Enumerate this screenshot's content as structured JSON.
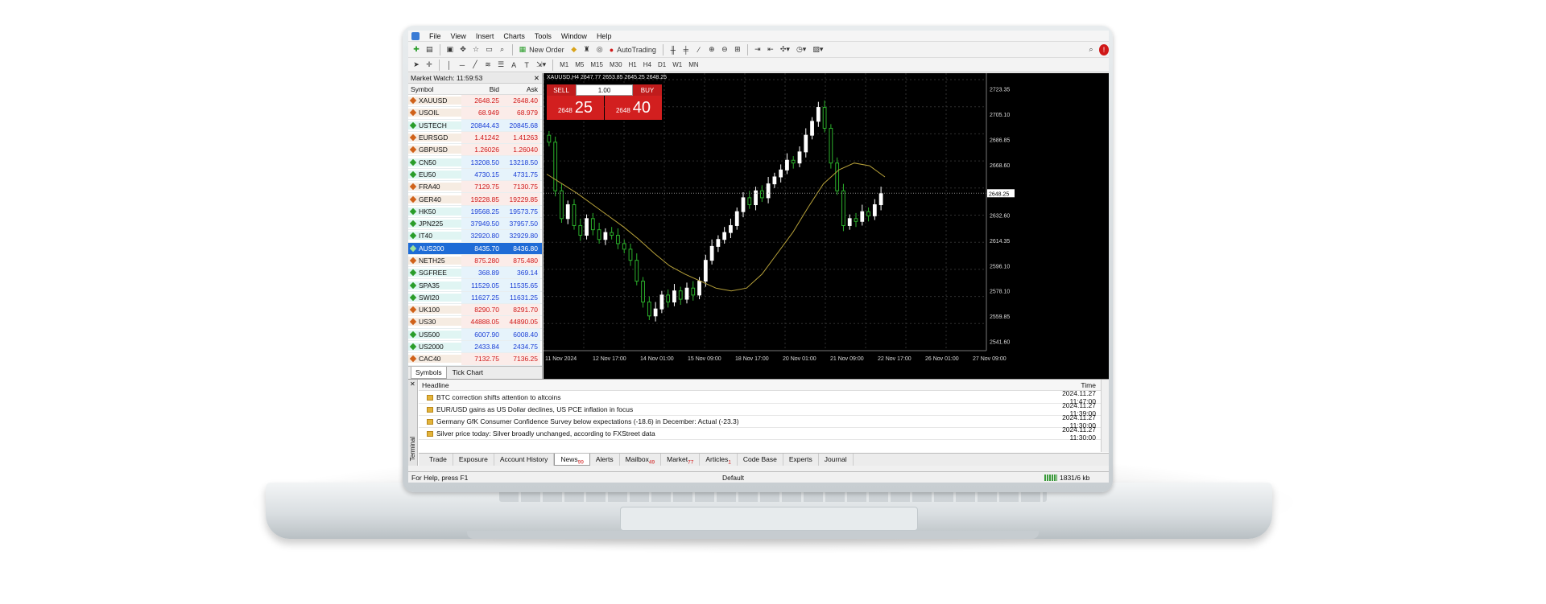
{
  "menu": [
    "File",
    "View",
    "Insert",
    "Charts",
    "Tools",
    "Window",
    "Help"
  ],
  "toolbar": {
    "new_order": "New Order",
    "autotrading": "AutoTrading"
  },
  "timeframes": [
    "M1",
    "M5",
    "M15",
    "M30",
    "H1",
    "H4",
    "D1",
    "W1",
    "MN"
  ],
  "market_watch": {
    "title": "Market Watch: 11:59:53",
    "headers": {
      "symbol": "Symbol",
      "bid": "Bid",
      "ask": "Ask"
    },
    "rows": [
      {
        "symbol": "XAUUSD",
        "bid": "2648.25",
        "ask": "2648.40",
        "dir": "down"
      },
      {
        "symbol": "USOIL",
        "bid": "68.949",
        "ask": "68.979",
        "dir": "down"
      },
      {
        "symbol": "USTECH",
        "bid": "20844.43",
        "ask": "20845.68",
        "dir": "up"
      },
      {
        "symbol": "EURSGD",
        "bid": "1.41242",
        "ask": "1.41263",
        "dir": "down"
      },
      {
        "symbol": "GBPUSD",
        "bid": "1.26026",
        "ask": "1.26040",
        "dir": "down"
      },
      {
        "symbol": "CN50",
        "bid": "13208.50",
        "ask": "13218.50",
        "dir": "up"
      },
      {
        "symbol": "EU50",
        "bid": "4730.15",
        "ask": "4731.75",
        "dir": "up"
      },
      {
        "symbol": "FRA40",
        "bid": "7129.75",
        "ask": "7130.75",
        "dir": "down"
      },
      {
        "symbol": "GER40",
        "bid": "19228.85",
        "ask": "19229.85",
        "dir": "down"
      },
      {
        "symbol": "HK50",
        "bid": "19568.25",
        "ask": "19573.75",
        "dir": "up"
      },
      {
        "symbol": "JPN225",
        "bid": "37949.50",
        "ask": "37957.50",
        "dir": "up"
      },
      {
        "symbol": "IT40",
        "bid": "32920.80",
        "ask": "32929.80",
        "dir": "up"
      },
      {
        "symbol": "AUS200",
        "bid": "8435.70",
        "ask": "8436.80",
        "dir": "sel"
      },
      {
        "symbol": "NETH25",
        "bid": "875.280",
        "ask": "875.480",
        "dir": "down"
      },
      {
        "symbol": "SGFREE",
        "bid": "368.89",
        "ask": "369.14",
        "dir": "up"
      },
      {
        "symbol": "SPA35",
        "bid": "11529.05",
        "ask": "11535.65",
        "dir": "up"
      },
      {
        "symbol": "SWI20",
        "bid": "11627.25",
        "ask": "11631.25",
        "dir": "up"
      },
      {
        "symbol": "UK100",
        "bid": "8290.70",
        "ask": "8291.70",
        "dir": "down"
      },
      {
        "symbol": "US30",
        "bid": "44888.05",
        "ask": "44890.05",
        "dir": "down"
      },
      {
        "symbol": "US500",
        "bid": "6007.90",
        "ask": "6008.40",
        "dir": "up"
      },
      {
        "symbol": "US2000",
        "bid": "2433.84",
        "ask": "2434.75",
        "dir": "up"
      },
      {
        "symbol": "CAC40",
        "bid": "7132.75",
        "ask": "7136.25",
        "dir": "down"
      }
    ],
    "tabs": [
      "Symbols",
      "Tick Chart"
    ]
  },
  "chart": {
    "title": "XAUUSD,H4  2647.77 2653.85 2645.25 2648.25",
    "sell_label": "SELL",
    "buy_label": "BUY",
    "lot": "1.00",
    "sell_small": "2648",
    "sell_big": "25",
    "buy_small": "2648",
    "buy_big": "40",
    "price_labels": [
      "2723.35",
      "2705.10",
      "2686.85",
      "2668.60",
      "2648.25",
      "2632.60",
      "2614.35",
      "2596.10",
      "2578.10",
      "2559.85",
      "2541.60"
    ],
    "time_labels": [
      "11 Nov 2024",
      "12 Nov 17:00",
      "14 Nov 01:00",
      "15 Nov 09:00",
      "18 Nov 17:00",
      "20 Nov 01:00",
      "21 Nov 09:00",
      "22 Nov 17:00",
      "26 Nov 01:00",
      "27 Nov 09:00"
    ],
    "colors": {
      "up": "#ffffff",
      "down": "#2bb02b",
      "ma": "#b8a23a",
      "grid": "#2f2f2f"
    }
  },
  "chart_data": {
    "type": "candlestick",
    "symbol": "XAUUSD",
    "timeframe": "H4",
    "ylim": [
      2535,
      2730
    ],
    "series": [
      {
        "name": "price",
        "values": [
          2685,
          2650,
          2630,
          2640,
          2625,
          2618,
          2630,
          2622,
          2615,
          2620,
          2618,
          2612,
          2608,
          2600,
          2585,
          2570,
          2560,
          2565,
          2575,
          2570,
          2578,
          2572,
          2580,
          2575,
          2585,
          2600,
          2610,
          2615,
          2620,
          2625,
          2635,
          2645,
          2640,
          2650,
          2645,
          2655,
          2660,
          2665,
          2672,
          2670,
          2678,
          2690,
          2700,
          2710,
          2695,
          2670,
          2650,
          2625,
          2630,
          2628,
          2635,
          2632,
          2640,
          2648
        ]
      },
      {
        "name": "ma",
        "values": [
          2662,
          2655,
          2648,
          2640,
          2632,
          2624,
          2615,
          2605,
          2596,
          2590,
          2585,
          2580,
          2578,
          2580,
          2590,
          2605,
          2620,
          2638,
          2655,
          2665,
          2670,
          2668,
          2660
        ]
      }
    ]
  },
  "terminal": {
    "side_label": "Terminal",
    "headers": {
      "headline": "Headline",
      "time": "Time"
    },
    "news": [
      {
        "headline": "BTC correction shifts attention to altcoins",
        "time": "2024.11.27 11:47:00"
      },
      {
        "headline": "EUR/USD gains as US Dollar declines, US PCE inflation in focus",
        "time": "2024.11.27 11:39:00"
      },
      {
        "headline": "Germany GfK Consumer Confidence Survey below expectations (-18.6) in December: Actual (-23.3)",
        "time": "2024.11.27 11:30:00"
      },
      {
        "headline": "Silver price today: Silver broadly unchanged, according to FXStreet data",
        "time": "2024.11.27 11:30:00"
      }
    ],
    "tabs": [
      {
        "label": "Trade",
        "badge": ""
      },
      {
        "label": "Exposure",
        "badge": ""
      },
      {
        "label": "Account History",
        "badge": ""
      },
      {
        "label": "News",
        "badge": "99"
      },
      {
        "label": "Alerts",
        "badge": ""
      },
      {
        "label": "Mailbox",
        "badge": "49"
      },
      {
        "label": "Market",
        "badge": "77"
      },
      {
        "label": "Articles",
        "badge": "1"
      },
      {
        "label": "Code Base",
        "badge": ""
      },
      {
        "label": "Experts",
        "badge": ""
      },
      {
        "label": "Journal",
        "badge": ""
      }
    ]
  },
  "status": {
    "help": "For Help, press F1",
    "profile": "Default",
    "traffic": "1831/6 kb"
  }
}
